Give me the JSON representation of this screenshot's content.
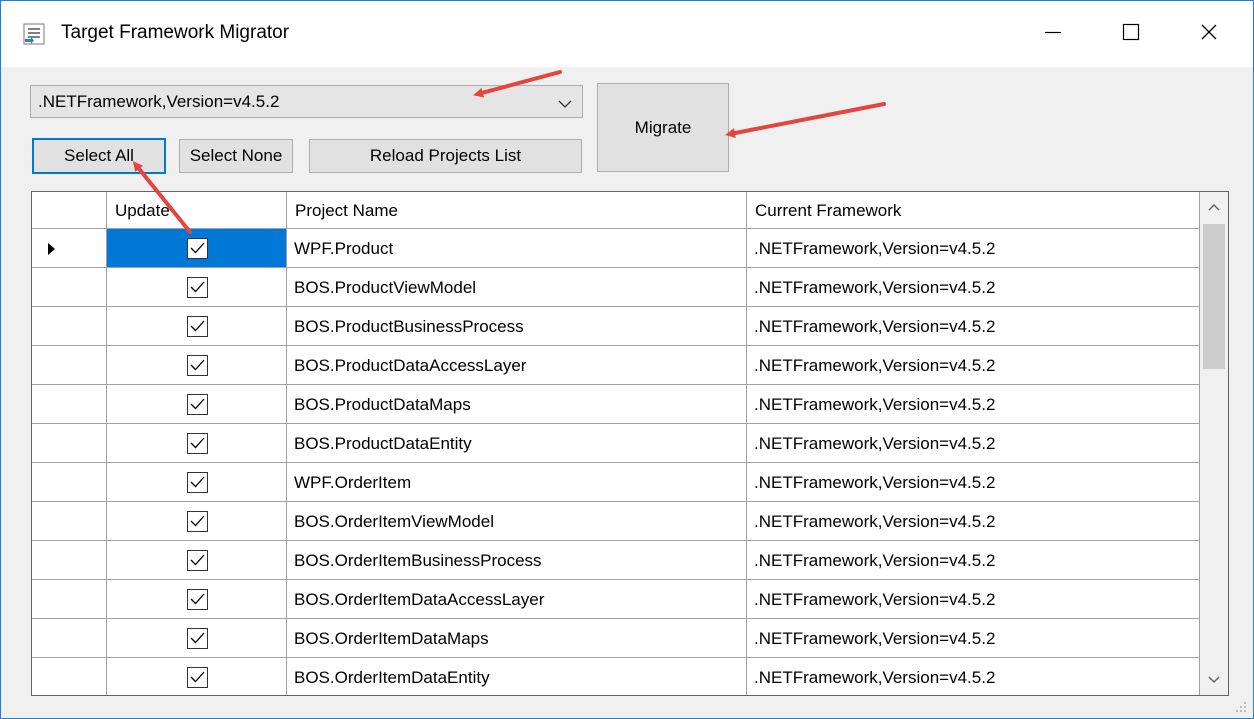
{
  "window": {
    "title": "Target Framework Migrator",
    "icons": {
      "app": "app-list-icon",
      "minimize": "minimize-icon",
      "maximize": "maximize-icon",
      "close": "close-icon"
    }
  },
  "toolbar": {
    "framework_selected": ".NETFramework,Version=v4.5.2",
    "select_all_label": "Select All",
    "select_none_label": "Select None",
    "reload_label": "Reload Projects List",
    "migrate_label": "Migrate"
  },
  "grid": {
    "columns": {
      "update": "Update",
      "project_name": "Project Name",
      "current_framework": "Current Framework"
    },
    "rows": [
      {
        "project_name": "WPF.Product",
        "current_framework": ".NETFramework,Version=v4.5.2",
        "update": true
      },
      {
        "project_name": "BOS.ProductViewModel",
        "current_framework": ".NETFramework,Version=v4.5.2",
        "update": true
      },
      {
        "project_name": "BOS.ProductBusinessProcess",
        "current_framework": ".NETFramework,Version=v4.5.2",
        "update": true
      },
      {
        "project_name": "BOS.ProductDataAccessLayer",
        "current_framework": ".NETFramework,Version=v4.5.2",
        "update": true
      },
      {
        "project_name": "BOS.ProductDataMaps",
        "current_framework": ".NETFramework,Version=v4.5.2",
        "update": true
      },
      {
        "project_name": "BOS.ProductDataEntity",
        "current_framework": ".NETFramework,Version=v4.5.2",
        "update": true
      },
      {
        "project_name": "WPF.OrderItem",
        "current_framework": ".NETFramework,Version=v4.5.2",
        "update": true
      },
      {
        "project_name": "BOS.OrderItemViewModel",
        "current_framework": ".NETFramework,Version=v4.5.2",
        "update": true
      },
      {
        "project_name": "BOS.OrderItemBusinessProcess",
        "current_framework": ".NETFramework,Version=v4.5.2",
        "update": true
      },
      {
        "project_name": "BOS.OrderItemDataAccessLayer",
        "current_framework": ".NETFramework,Version=v4.5.2",
        "update": true
      },
      {
        "project_name": "BOS.OrderItemDataMaps",
        "current_framework": ".NETFramework,Version=v4.5.2",
        "update": true
      },
      {
        "project_name": "BOS.OrderItemDataEntity",
        "current_framework": ".NETFramework,Version=v4.5.2",
        "update": true
      }
    ]
  },
  "colors": {
    "accent": "#0078d7",
    "annotation_arrow": "#e2463f",
    "window_border": "#1e7fd8"
  }
}
